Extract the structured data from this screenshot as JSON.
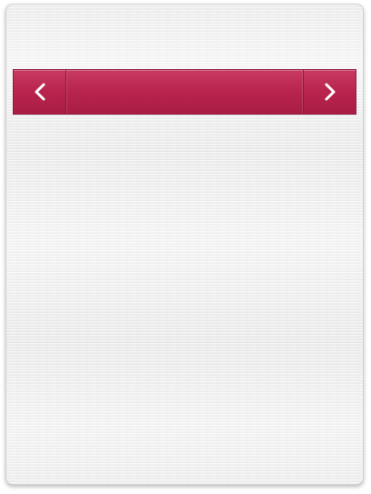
{
  "nav": {
    "title": "",
    "prev_icon": "chevron-left-icon",
    "next_icon": "chevron-right-icon",
    "accent_color": "#b8244c"
  }
}
